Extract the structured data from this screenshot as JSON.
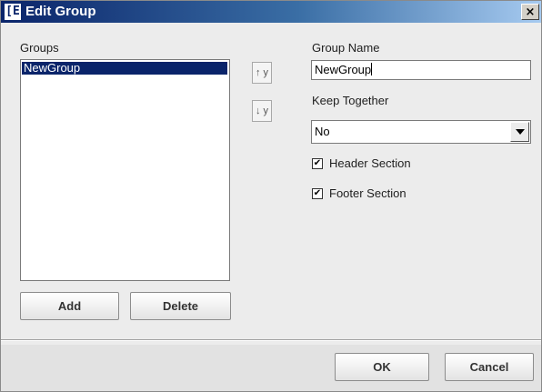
{
  "window": {
    "title": "Edit Group",
    "icon_glyph": "[E",
    "close_glyph": "×"
  },
  "groups": {
    "label": "Groups",
    "items": [
      {
        "label": "NewGroup",
        "selected": true
      }
    ],
    "add_label": "Add",
    "delete_label": "Delete"
  },
  "move": {
    "up_label": "↑ y",
    "down_label": "↓ y"
  },
  "group_name": {
    "label": "Group Name",
    "value": "NewGroup"
  },
  "keep_together": {
    "label": "Keep Together",
    "value": "No"
  },
  "header_section": {
    "label": "Header Section",
    "checked": true,
    "mark": "✔"
  },
  "footer_section": {
    "label": "Footer Section",
    "checked": true,
    "mark": "✔"
  },
  "dialog": {
    "ok_label": "OK",
    "cancel_label": "Cancel"
  },
  "colors": {
    "title_start": "#0a246a",
    "title_end": "#a6caf0",
    "selection": "#0a246a",
    "window_bg": "#ececec"
  }
}
